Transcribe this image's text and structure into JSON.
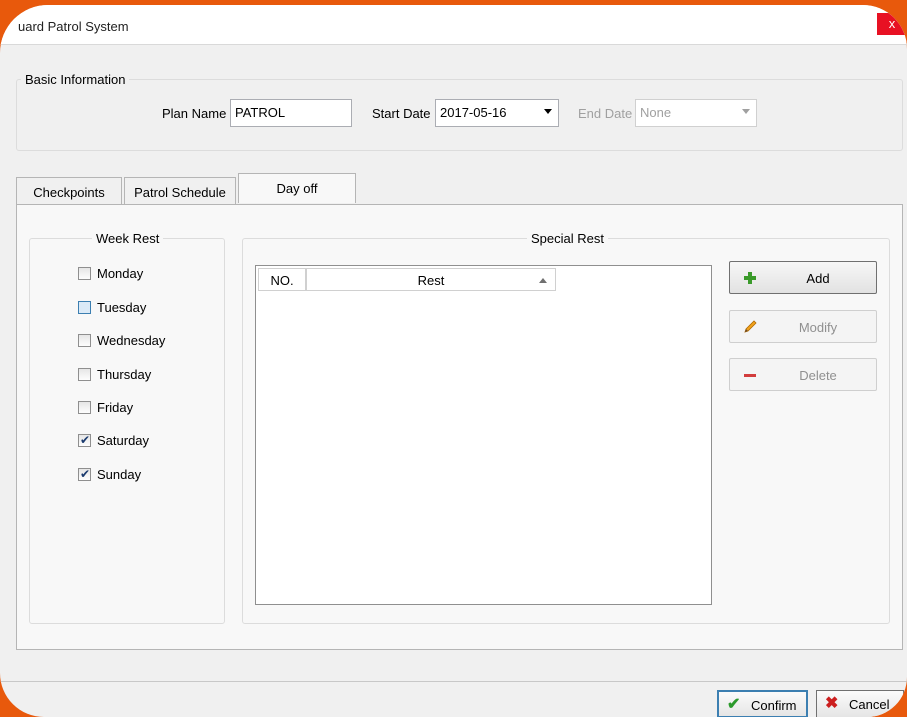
{
  "window": {
    "title": "uard Patrol System",
    "close_label": "x"
  },
  "basic_info": {
    "group_label": "Basic Information",
    "plan_name_label": "Plan Name",
    "plan_name_value": "PATROL",
    "start_date_label": "Start Date",
    "start_date_value": "2017-05-16",
    "end_date_label": "End Date",
    "end_date_value": "None"
  },
  "tabs": [
    {
      "label": "Checkpoints"
    },
    {
      "label": "Patrol Schedule"
    },
    {
      "label": "Day off",
      "active": true
    }
  ],
  "week_rest": {
    "group_label": "Week Rest",
    "days": [
      {
        "label": "Monday",
        "checked": false
      },
      {
        "label": "Tuesday",
        "checked": false,
        "focused": true
      },
      {
        "label": "Wednesday",
        "checked": false
      },
      {
        "label": "Thursday",
        "checked": false
      },
      {
        "label": "Friday",
        "checked": false
      },
      {
        "label": "Saturday",
        "checked": true
      },
      {
        "label": "Sunday",
        "checked": true
      }
    ]
  },
  "special_rest": {
    "group_label": "Special Rest",
    "columns": [
      "NO.",
      "Rest"
    ],
    "rows": [],
    "add_label": "Add",
    "modify_label": "Modify",
    "delete_label": "Delete"
  },
  "footer": {
    "confirm_label": "Confirm",
    "cancel_label": "Cancel"
  },
  "icons": {
    "add": "plus-icon",
    "modify": "pencil-icon",
    "delete": "minus-icon",
    "confirm": "checkmark-icon",
    "cancel": "x-icon"
  },
  "colors": {
    "accent_frame": "#e8590c",
    "close_button": "#e81123",
    "add_icon": "#3a9a2a",
    "delete_icon": "#d23c3c",
    "confirm_icon": "#2c9a2c",
    "cancel_icon": "#cc1f1f"
  }
}
